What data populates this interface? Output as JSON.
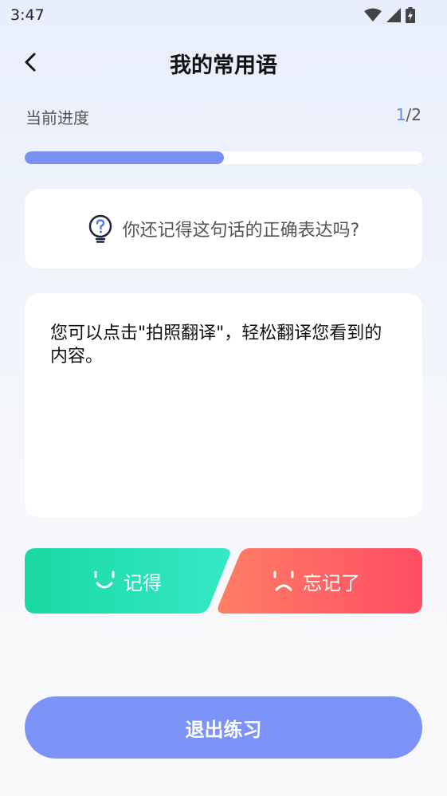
{
  "status_bar": {
    "time": "3:47"
  },
  "header": {
    "title": "我的常用语",
    "back_icon": "chevron-left-icon"
  },
  "progress": {
    "label": "当前进度",
    "current": "1",
    "separator": "/",
    "total": "2",
    "fraction": 0.5,
    "color": "#7a92f5"
  },
  "question": {
    "icon": "lightbulb-question-icon",
    "text": "你还记得这句话的正确表达吗?"
  },
  "phrase": {
    "text": "您可以点击\"拍照翻译\"，轻松翻译您看到的内容。"
  },
  "buttons": {
    "remember": {
      "label": "记得",
      "icon": "smile-icon",
      "colors": [
        "#19d8a2",
        "#36e8c6"
      ]
    },
    "forgot": {
      "label": "忘记了",
      "icon": "sad-icon",
      "colors": [
        "#ff7e65",
        "#ff4d63"
      ]
    },
    "exit": {
      "label": "退出练习",
      "color": "#7b93f7"
    }
  }
}
